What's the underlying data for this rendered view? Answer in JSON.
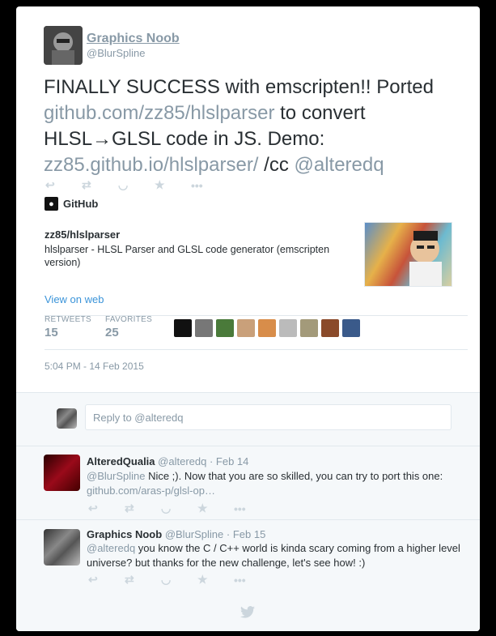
{
  "tweet": {
    "author_name": "Graphics Noob",
    "author_handle": "@BlurSpline",
    "text_part1": "FINALLY SUCCESS with emscripten!! Ported ",
    "link1": "github.com/zz85/hlslparser",
    "text_part2": " to convert HLSL→GLSL code in JS. Demo: ",
    "link2": "zz85.github.io/hlslparser/",
    "text_part3": " /cc ",
    "mention": "@alteredq",
    "actions": [
      "reply-icon",
      "retweet-icon",
      "pocket-icon",
      "favorite-icon",
      "more-icon"
    ]
  },
  "card": {
    "source": "GitHub",
    "title": "zz85/hlslparser",
    "description": "hlslparser - HLSL Parser and GLSL code generator (emscripten version)",
    "view_on_web": "View on web"
  },
  "stats": {
    "retweets_label": "RETWEETS",
    "retweets_value": "15",
    "favorites_label": "FAVORITES",
    "favorites_value": "25"
  },
  "timestamp": "5:04 PM - 14 Feb 2015",
  "reply_box": {
    "placeholder": "Reply to @alteredq"
  },
  "replies": [
    {
      "name": "AlteredQualia",
      "handle": "@alteredq",
      "date": "· Feb 14",
      "mention": "@BlurSpline",
      "text": " Nice ;). Now that you are so skilled, you can try to port this one:",
      "link": "github.com/aras-p/glsl-op…"
    },
    {
      "name": "Graphics Noob",
      "handle": "@BlurSpline",
      "date": "· Feb 15",
      "mention": "@alteredq",
      "text": " you know the C / C++ world is kinda scary coming from a higher level universe? but thanks for the new challenge, let's see how! :)"
    }
  ],
  "footer_icon": "twitter-bird-icon"
}
